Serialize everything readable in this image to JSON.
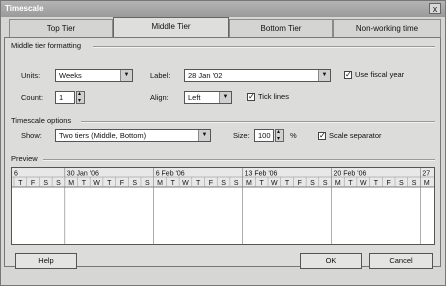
{
  "window": {
    "title": "Timescale",
    "close": "x"
  },
  "tabs": [
    "Top Tier",
    "Middle Tier",
    "Bottom Tier",
    "Non-working time"
  ],
  "middle_tier": {
    "group_title": "Middle tier formatting",
    "units_label": "Units:",
    "units_value": "Weeks",
    "label_label": "Label:",
    "label_value": "28 Jan '02",
    "use_fiscal_year": "Use fiscal year",
    "count_label": "Count:",
    "count_value": "1",
    "align_label": "Align:",
    "align_value": "Left",
    "tick_lines": "Tick lines"
  },
  "timescale_options": {
    "group_title": "Timescale options",
    "show_label": "Show:",
    "show_value": "Two tiers (Middle, Bottom)",
    "size_label": "Size:",
    "size_value": "100",
    "size_unit": "%",
    "scale_separator": "Scale separator"
  },
  "preview": {
    "title": "Preview",
    "weeks": [
      "6",
      "30 Jan '06",
      "6 Feb '06",
      "13 Feb '06",
      "20 Feb '06",
      "27"
    ],
    "days": [
      "T",
      "F",
      "S",
      "S",
      "M",
      "T",
      "W",
      "T",
      "F",
      "S",
      "S",
      "M",
      "T",
      "W",
      "T",
      "F",
      "S",
      "S",
      "M",
      "T",
      "W",
      "T",
      "F",
      "S",
      "S",
      "M",
      "T",
      "W",
      "T",
      "F",
      "S",
      "S",
      "M"
    ]
  },
  "buttons": {
    "help": "Help",
    "ok": "OK",
    "cancel": "Cancel"
  }
}
